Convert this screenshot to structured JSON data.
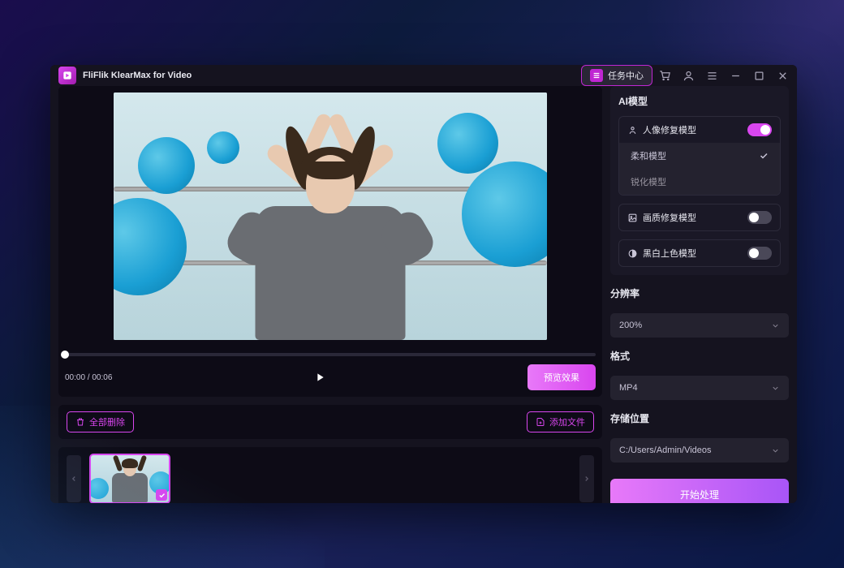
{
  "app": {
    "title": "FliFlik KlearMax for Video"
  },
  "titlebar": {
    "task_center": "任务中心"
  },
  "player": {
    "current_time": "00:00",
    "total_time": "00:06",
    "time_separator": " / ",
    "preview_button": "预览效果"
  },
  "file_actions": {
    "delete_all": "全部删除",
    "add_file": "添加文件"
  },
  "sidebar": {
    "ai_model_title": "AI模型",
    "portrait": {
      "label": "人像修复模型",
      "enabled": true,
      "sub": [
        {
          "label": "柔和模型",
          "selected": true
        },
        {
          "label": "锐化模型",
          "selected": false
        }
      ]
    },
    "quality": {
      "label": "画质修复模型",
      "enabled": false
    },
    "colorize": {
      "label": "黑白上色模型",
      "enabled": false
    },
    "resolution": {
      "label": "分辨率",
      "value": "200%"
    },
    "format": {
      "label": "格式",
      "value": "MP4"
    },
    "storage": {
      "label": "存储位置",
      "value": "C:/Users/Admin/Videos"
    },
    "start_button": "开始处理"
  }
}
